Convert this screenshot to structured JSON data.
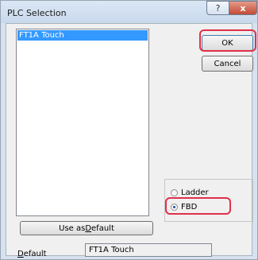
{
  "window": {
    "title": "PLC Selection"
  },
  "titlebar": {
    "help_glyph": "?",
    "close_glyph": "x"
  },
  "plc_list": {
    "items": [
      "FT1A Touch"
    ],
    "selected_index": 0
  },
  "buttons": {
    "ok_label": "OK",
    "cancel_label": "Cancel",
    "use_default_pre": "Use as ",
    "use_default_hotkey": "D",
    "use_default_post": "efault"
  },
  "language_group": {
    "options": [
      {
        "label": "Ladder",
        "checked": false
      },
      {
        "label": "FBD",
        "checked": true
      }
    ]
  },
  "default": {
    "label_hotkey": "D",
    "label_rest": "efault",
    "value": "FT1A Touch"
  },
  "colors": {
    "highlight": "#e0304a",
    "selection": "#3399ff"
  }
}
